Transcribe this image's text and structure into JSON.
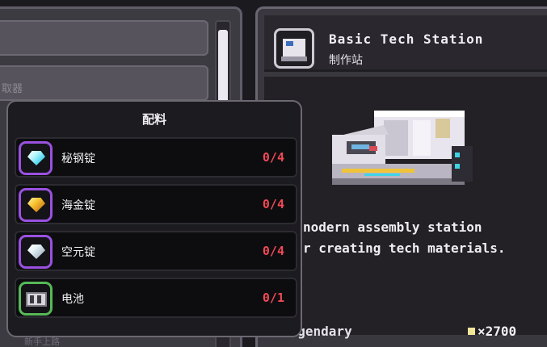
{
  "left_panel": {
    "hint_text": "取器",
    "bottom_hint": "新手上路"
  },
  "materials_popup": {
    "title": "配料",
    "items": [
      {
        "name": "秘钢锭",
        "count": "0/4",
        "icon": "cyan-ingot-icon"
      },
      {
        "name": "海金锭",
        "count": "0/4",
        "icon": "gold-ingot-icon"
      },
      {
        "name": "空元锭",
        "count": "0/4",
        "icon": "silver-ingot-icon"
      },
      {
        "name": "电池",
        "count": "0/1",
        "icon": "battery-icon"
      }
    ],
    "count_color": "#f04a55"
  },
  "detail": {
    "title": "Basic Tech Station",
    "subtitle": "制作站",
    "description": "nodern assembly station\nr creating tech materials.",
    "rarity": "Legendary",
    "price": "×2700"
  },
  "colors": {
    "accent_purple": "#9a51e0",
    "accent_green": "#56b957",
    "coin": "#f1e69a"
  }
}
